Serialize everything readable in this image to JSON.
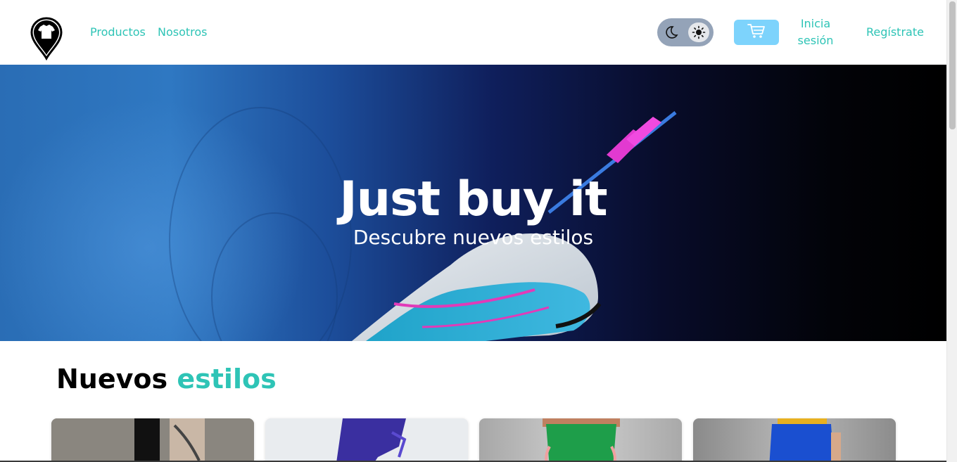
{
  "nav": {
    "productos": "Productos",
    "nosotros": "Nosotros"
  },
  "header": {
    "login_line1": "Inicia",
    "login_line2": "sesión",
    "register": "Regístrate"
  },
  "hero": {
    "title": "Just buy it",
    "subtitle": "Descubre nuevos estilos"
  },
  "section": {
    "title_part1": "Nuevos",
    "title_part2": "estilos"
  },
  "icons": {
    "logo": "shirt-pin-logo",
    "theme_dark": "moon-icon",
    "theme_light": "sun-icon",
    "cart": "cart-icon"
  },
  "colors": {
    "accent": "#2ec4b6",
    "cart_button": "#7dd3fc",
    "toggle": "#94a3b8"
  }
}
